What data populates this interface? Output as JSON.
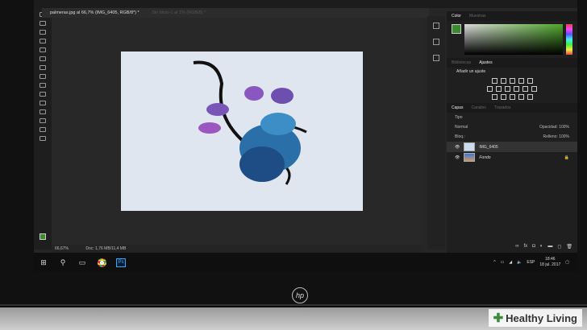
{
  "document_tab": {
    "active": "palmeras.jpg al 66,7% (IMG_6405, RGB/8*) *",
    "inactive": "Sin título-1 al 1% (RGB/8) *"
  },
  "status": {
    "zoom": "66,67%",
    "doc": "Doc: 1,76 MB/11,4 MB"
  },
  "color_panel": {
    "tabs": [
      "Color",
      "Muestras"
    ],
    "fg_color": "#3c8a2e"
  },
  "adjust_panel": {
    "tabs": [
      "Bibliotecas",
      "Ajustes"
    ],
    "title": "Añadir un ajuste"
  },
  "layers_panel": {
    "tabs": [
      "Capas",
      "Canales",
      "Trazados"
    ],
    "filter": "Tipo",
    "blend_mode": "Normal",
    "opacity_label": "Opacidad:",
    "opacity": "100%",
    "lock_label": "Bloq.:",
    "fill_label": "Relleno:",
    "fill": "100%",
    "layers": [
      {
        "name": "IMG_6405",
        "selected": true
      },
      {
        "name": "Fondo",
        "locked": true
      }
    ]
  },
  "tray": {
    "language": "ESP",
    "time": "18:46",
    "date": "18 jul. 2017"
  },
  "brand": {
    "logo": "hp",
    "watermark": "Healthy Living"
  }
}
